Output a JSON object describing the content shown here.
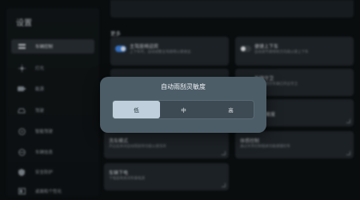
{
  "sidebar": {
    "title": "设置",
    "items": [
      {
        "label": "车辆控制",
        "icon": "car-control-icon",
        "active": true
      },
      {
        "label": "灯光",
        "icon": "light-icon",
        "active": false
      },
      {
        "label": "能源",
        "icon": "battery-icon",
        "active": false
      },
      {
        "label": "驾驶",
        "icon": "steering-car-icon",
        "active": false
      },
      {
        "label": "智能驾驶",
        "icon": "steering-wheel-icon",
        "active": false
      },
      {
        "label": "车辆信息",
        "icon": "info-icon",
        "active": false
      },
      {
        "label": "安全防护",
        "icon": "shield-icon",
        "active": false
      },
      {
        "label": "桌面和个性化",
        "icon": "desktop-icon",
        "active": false
      }
    ]
  },
  "main": {
    "section_label": "更多",
    "cards": [
      {
        "title": "主驾座椅迎宾",
        "subtitle": "上下车时，自动调整主驾座椅以便进出",
        "toggle": "on"
      },
      {
        "title": "便捷上下车",
        "subtitle": "自动调节座椅和方向盘以便上下车",
        "toggle": "off"
      },
      {
        "title": "车辆守卫",
        "subtitle": "离车后提示车辆已开启守卫",
        "toggle": "off"
      },
      {
        "title": "敏度",
        "subtitle": ""
      },
      {
        "title": "洗车模式",
        "subtitle": "开启后关闭自动雨刮等功能以便洗车"
      },
      {
        "title": "体感控制",
        "subtitle": "通过手势控制相关功能便捷控车"
      },
      {
        "title": "车辆下电",
        "subtitle": "下电后将关闭车辆电源"
      }
    ]
  },
  "dialog": {
    "title": "自动雨刮灵敏度",
    "options": [
      "低",
      "中",
      "高"
    ],
    "selected_index": 0
  },
  "colors": {
    "accent": "#3f86e8",
    "dialog_bg": "#4c5d68",
    "selected_option_bg": "#bfd0dc"
  }
}
